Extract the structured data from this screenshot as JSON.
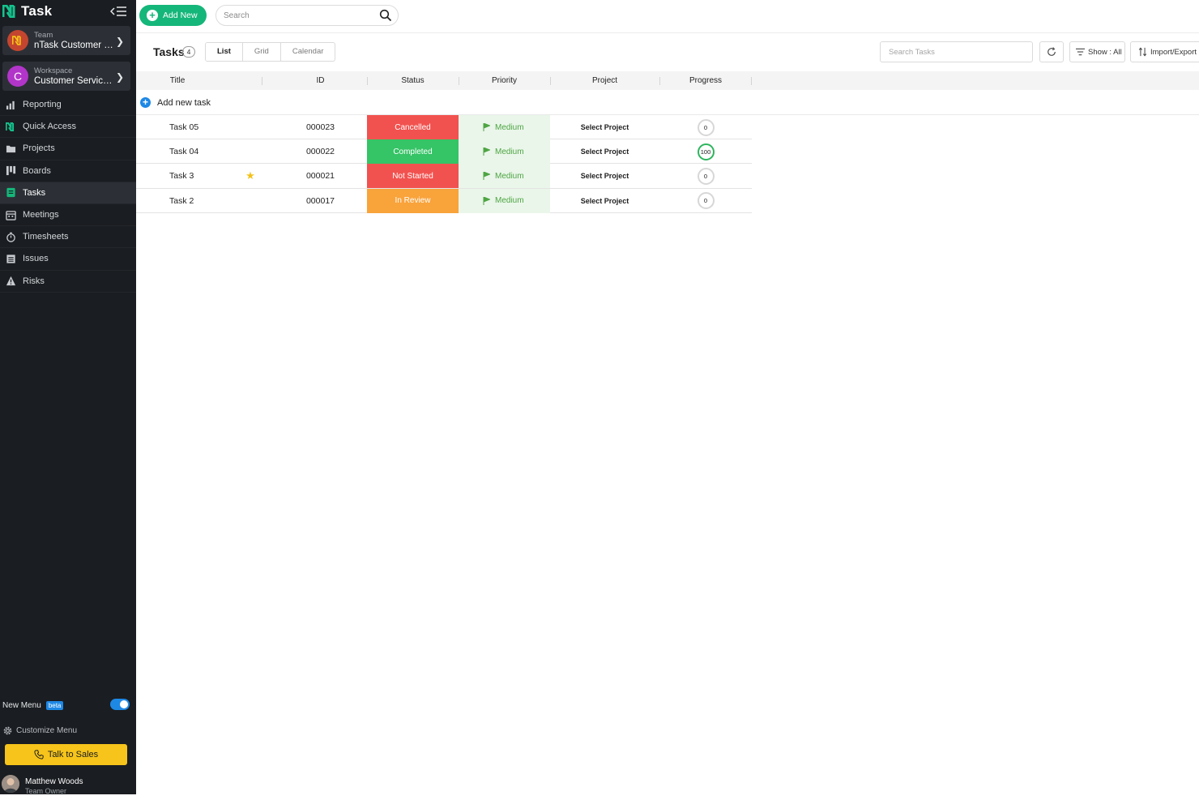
{
  "app": {
    "title": "Task"
  },
  "sidebar": {
    "team": {
      "label": "Team",
      "value": "nTask Customer S..."
    },
    "workspace": {
      "label": "Workspace",
      "value": "Customer Service...",
      "initial": "C"
    },
    "items": [
      {
        "label": "Reporting",
        "icon": "bar-chart-icon"
      },
      {
        "label": "Quick Access",
        "icon": "ntask-logo-icon"
      },
      {
        "label": "Projects",
        "icon": "folder-icon"
      },
      {
        "label": "Boards",
        "icon": "kanban-icon"
      },
      {
        "label": "Tasks",
        "icon": "tasks-icon",
        "active": true
      },
      {
        "label": "Meetings",
        "icon": "calendar-icon"
      },
      {
        "label": "Timesheets",
        "icon": "stopwatch-icon"
      },
      {
        "label": "Issues",
        "icon": "list-icon"
      },
      {
        "label": "Risks",
        "icon": "warning-icon"
      }
    ],
    "new_menu": {
      "label": "New Menu",
      "badge": "beta",
      "enabled": true
    },
    "customize": "Customize Menu",
    "talk_to_sales": "Talk to Sales",
    "user": {
      "name": "Matthew Woods",
      "role": "Team Owner"
    }
  },
  "topbar": {
    "add_new": "Add New",
    "search_placeholder": "Search"
  },
  "page": {
    "title": "Tasks",
    "count": "4",
    "views": [
      "List",
      "Grid",
      "Calendar"
    ],
    "active_view": "List",
    "search_placeholder": "Search Tasks",
    "show_label": "Show : All",
    "import_export": "Import/Export"
  },
  "table": {
    "columns": [
      "Title",
      "ID",
      "Status",
      "Priority",
      "Project",
      "Progress"
    ],
    "add_new_task": "Add new task",
    "rows": [
      {
        "title": "Task 05",
        "id": "000023",
        "status": "Cancelled",
        "status_color": "#f2524f",
        "priority": "Medium",
        "project": "Select Project",
        "progress": "0",
        "starred": false
      },
      {
        "title": "Task 04",
        "id": "000022",
        "status": "Completed",
        "status_color": "#35c466",
        "priority": "Medium",
        "project": "Select Project",
        "progress": "100",
        "starred": false
      },
      {
        "title": "Task 3",
        "id": "000021",
        "status": "Not Started",
        "status_color": "#f2524f",
        "priority": "Medium",
        "project": "Select Project",
        "progress": "0",
        "starred": true
      },
      {
        "title": "Task 2",
        "id": "000017",
        "status": "In Review",
        "status_color": "#f9a33b",
        "priority": "Medium",
        "project": "Select Project",
        "progress": "0",
        "starred": false
      }
    ]
  },
  "colors": {
    "sidebar_bg": "#1a1d21",
    "accent_green": "#15b67a",
    "accent_blue": "#1e88e5",
    "sales_yellow": "#f6c41a",
    "priority_green": "#4ea543"
  }
}
